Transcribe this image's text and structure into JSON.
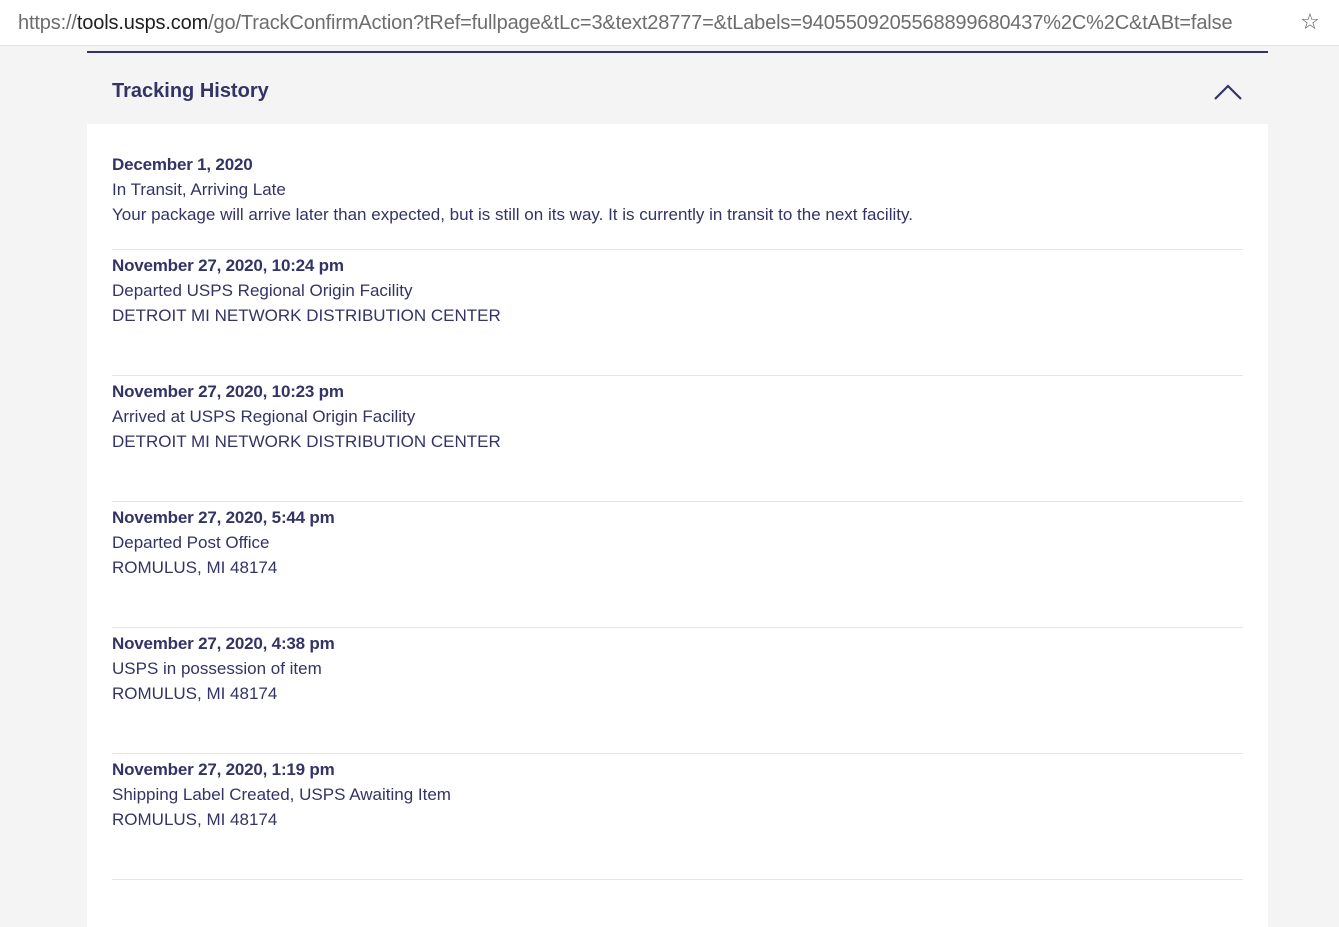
{
  "browser": {
    "url_scheme": "https://",
    "url_host": "tools.usps.com",
    "url_path": "/go/TrackConfirmAction?tRef=fullpage&tLc=3&text28777=&tLabels=9405509205568899680437%2C%2C&tABt=false",
    "star_glyph": "☆"
  },
  "history": {
    "title": "Tracking History",
    "expanded": true,
    "events": [
      {
        "date": "December 1, 2020",
        "status": "In Transit, Arriving Late",
        "detail": "Your package will arrive later than expected, but is still on its way. It is currently in transit to the next facility."
      },
      {
        "date": "November 27, 2020, 10:24 pm",
        "status": "Departed USPS Regional Origin Facility",
        "detail": "DETROIT MI NETWORK DISTRIBUTION CENTER"
      },
      {
        "date": "November 27, 2020, 10:23 pm",
        "status": "Arrived at USPS Regional Origin Facility",
        "detail": "DETROIT MI NETWORK DISTRIBUTION CENTER"
      },
      {
        "date": "November 27, 2020, 5:44 pm",
        "status": "Departed Post Office",
        "detail": "ROMULUS, MI 48174"
      },
      {
        "date": "November 27, 2020, 4:38 pm",
        "status": "USPS in possession of item",
        "detail": "ROMULUS, MI 48174"
      },
      {
        "date": "November 27, 2020, 1:19 pm",
        "status": "Shipping Label Created, USPS Awaiting Item",
        "detail": "ROMULUS, MI 48174"
      }
    ]
  },
  "colors": {
    "brand_navy": "#333366",
    "page_bg": "#f4f4f4",
    "card_bg": "#ffffff",
    "divider": "#e6e6e6"
  }
}
